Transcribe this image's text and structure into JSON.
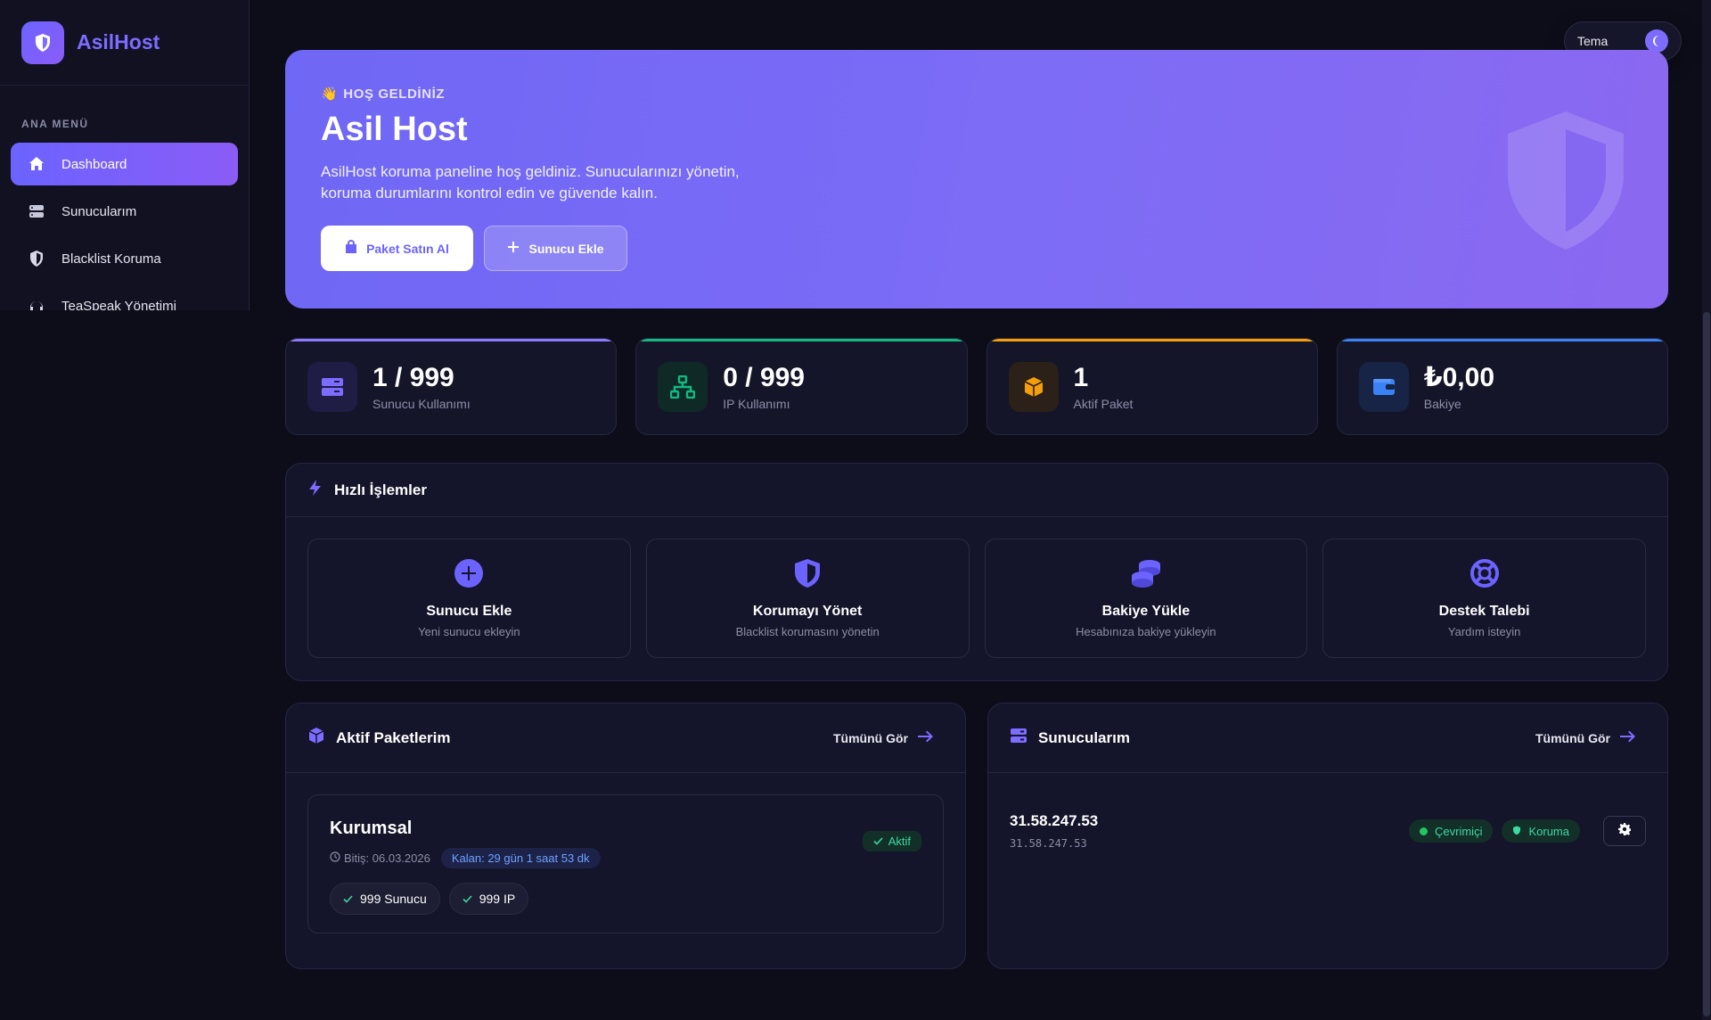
{
  "brand": {
    "name": "AsilHost"
  },
  "sidebar": {
    "menu_title": "ANA MENÜ",
    "items": [
      {
        "label": "Dashboard",
        "icon": "home-icon"
      },
      {
        "label": "Sunucularım",
        "icon": "server-icon"
      },
      {
        "label": "Blacklist Koruma",
        "icon": "shield-icon"
      },
      {
        "label": "TeaSpeak Yönetimi",
        "icon": "headset-icon"
      }
    ]
  },
  "theme": {
    "label": "Tema",
    "icon": "moon-icon"
  },
  "hero": {
    "kicker": "HOŞ GELDİNİZ",
    "title": "Asil Host",
    "description": "AsilHost koruma paneline hoş geldiniz. Sunucularınızı yönetin, koruma durumlarını kontrol edin ve güvende kalın.",
    "buttons": {
      "buy": "Paket Satın Al",
      "add_server": "Sunucu Ekle"
    }
  },
  "stats": [
    {
      "value": "1 / 999",
      "label": "Sunucu Kullanımı",
      "color": "#8b7cff"
    },
    {
      "value": "0 / 999",
      "label": "IP Kullanımı",
      "color": "#12b981"
    },
    {
      "value": "1",
      "label": "Aktif Paket",
      "color": "#f59e0b"
    },
    {
      "value": "₺0,00",
      "label": "Bakiye",
      "color": "#3b82f6"
    }
  ],
  "quick_actions": {
    "title": "Hızlı İşlemler",
    "items": [
      {
        "title": "Sunucu Ekle",
        "subtitle": "Yeni sunucu ekleyin"
      },
      {
        "title": "Korumayı Yönet",
        "subtitle": "Blacklist korumasını yönetin"
      },
      {
        "title": "Bakiye Yükle",
        "subtitle": "Hesabınıza bakiye yükleyin"
      },
      {
        "title": "Destek Talebi",
        "subtitle": "Yardım isteyin"
      }
    ]
  },
  "packages": {
    "title": "Aktif Paketlerim",
    "see_all": "Tümünü Gör",
    "item": {
      "name": "Kurumsal",
      "expires": "Bitiş: 06.03.2026",
      "remaining": "Kalan: 29 gün 1 saat 53 dk",
      "status": "Aktif",
      "features": [
        "999 Sunucu",
        "999 IP"
      ]
    }
  },
  "servers": {
    "title": "Sunucularım",
    "see_all": "Tümünü Gör",
    "item": {
      "ip": "31.58.247.53",
      "sub": "31.58.247.53",
      "online": "Çevrimiçi",
      "protection": "Koruma"
    }
  }
}
